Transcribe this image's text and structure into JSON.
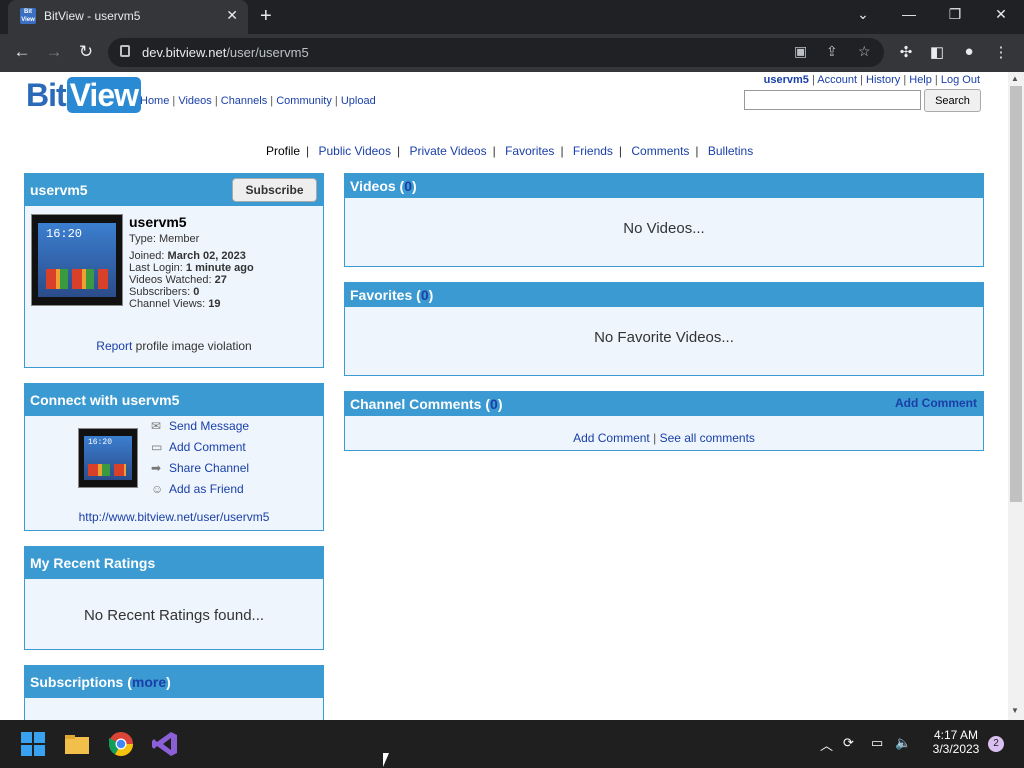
{
  "browser": {
    "tab_title": "BitView - uservm5",
    "tab_favicon_text": "Bit View",
    "url_domain": "dev.bitview.net",
    "url_path": "/user/uservm5"
  },
  "site": {
    "logo_bit": "Bit",
    "logo_view": "View",
    "main_nav": [
      "Home",
      "Videos",
      "Channels",
      "Community",
      "Upload"
    ],
    "user_nav": [
      "uservm5",
      "Account",
      "History",
      "Help",
      "Log Out"
    ],
    "search_button": "Search",
    "search_value": ""
  },
  "profile_nav": {
    "current": "Profile",
    "links": [
      "Public Videos",
      "Private Videos",
      "Favorites",
      "Friends",
      "Comments",
      "Bulletins"
    ]
  },
  "profile_box": {
    "header": "uservm5",
    "subscribe_label": "Subscribe",
    "name": "uservm5",
    "type_label": "Type: Member",
    "joined_label": "Joined:",
    "joined_value": "March 02, 2023",
    "last_login_label": "Last Login:",
    "last_login_value": "1 minute ago",
    "videos_watched_label": "Videos Watched:",
    "videos_watched_value": "27",
    "subscribers_label": "Subscribers:",
    "subscribers_value": "0",
    "channel_views_label": "Channel Views:",
    "channel_views_value": "19",
    "report_link": "Report",
    "report_text": " profile image violation",
    "avatar_clock": "16:20"
  },
  "connect_box": {
    "header": "Connect with uservm5",
    "send_message": "Send Message",
    "add_comment": "Add Comment",
    "share_channel": "Share Channel",
    "add_friend": "Add as Friend",
    "channel_url": "http://www.bitview.net/user/uservm5"
  },
  "ratings_box": {
    "header": "My Recent Ratings",
    "empty": "No Recent Ratings found..."
  },
  "subscriptions_box": {
    "header": "Subscriptions (",
    "more": "more",
    "header_end": ")"
  },
  "videos_box": {
    "header": "Videos (",
    "count": "0",
    "header_end": ")",
    "empty": "No Videos..."
  },
  "favorites_box": {
    "header": "Favorites (",
    "count": "0",
    "header_end": ")",
    "empty": "No Favorite Videos..."
  },
  "comments_box": {
    "header": "Channel Comments (",
    "count": "0",
    "header_end": ")",
    "add_comment_header": "Add Comment",
    "add_comment_link": "Add Comment",
    "see_all": "See all comments"
  },
  "taskbar": {
    "time": "4:17 AM",
    "date": "3/3/2023",
    "notifications": "2"
  }
}
